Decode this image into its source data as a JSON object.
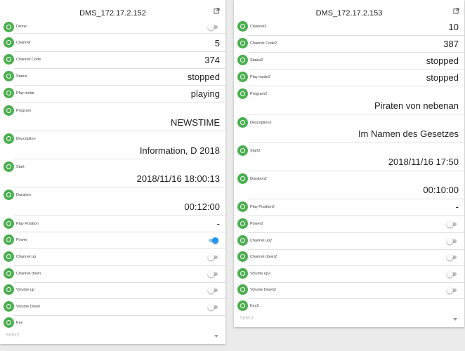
{
  "card1": {
    "title": "DMS_172.17.2.152",
    "drone_label": "Drone",
    "channel_label": "Channel",
    "channel_value": "5",
    "channel_code_label": "Channel Code",
    "channel_code_value": "374",
    "status_label": "Status",
    "status_value": "stopped",
    "play_mode_label": "Play mode",
    "play_mode_value": "playing",
    "program_label": "Program",
    "program_value": "NEWSTIME",
    "description_label": "Description",
    "description_value": "Information, D 2018",
    "start_label": "Start",
    "start_value": "2018/11/16 18:00:13",
    "duration_label": "Duration",
    "duration_value": "00:12:00",
    "play_position_label": "Play Position",
    "play_position_value": "-",
    "power_label": "Power",
    "channel_up_label": "Channel up",
    "channel_down_label": "Channel down",
    "volume_up_label": "Volume up",
    "volume_down_label": "Volume Down",
    "key_label": "Key",
    "select_placeholder": "Select",
    "toggles": {
      "drone": false,
      "power": true,
      "channel_up": false,
      "channel_down": false,
      "volume_up": false,
      "volume_down": false
    }
  },
  "card2": {
    "title": "DMS_172.17.2.153",
    "channel_label": "Channel2",
    "channel_value": "10",
    "channel_code_label": "Channel Code2",
    "channel_code_value": "387",
    "status_label": "Status2",
    "status_value": "stopped",
    "play_mode_label": "Play mode2",
    "play_mode_value": "stopped",
    "program_label": "Program2",
    "program_value": "Piraten von nebenan",
    "description_label": "Description2",
    "description_value": "Im Namen des Gesetzes",
    "start_label": "Start2",
    "start_value": "2018/11/16 17:50",
    "duration_label": "Duration2",
    "duration_value": "00:10:00",
    "play_position_label": "Play Position2",
    "play_position_value": "-",
    "power_label": "Power2",
    "channel_up_label": "Channel up2",
    "channel_down_label": "Channel down2",
    "volume_up_label": "Volume up2",
    "volume_down_label": "Volume Down2",
    "key_label": "Key2",
    "select_placeholder": "Select",
    "toggles": {
      "power": false,
      "channel_up": false,
      "channel_down": false,
      "volume_up": false,
      "volume_down": false
    }
  },
  "colors": {
    "accent_green": "#4caf50",
    "toggle_on": "#2196f3",
    "toggle_off": "#bdbdbd",
    "background": "#ebebeb"
  },
  "icons": {
    "state_badge": "state-circle-icon",
    "open_external": "open-external-icon",
    "dropdown": "chevron-down-icon"
  }
}
